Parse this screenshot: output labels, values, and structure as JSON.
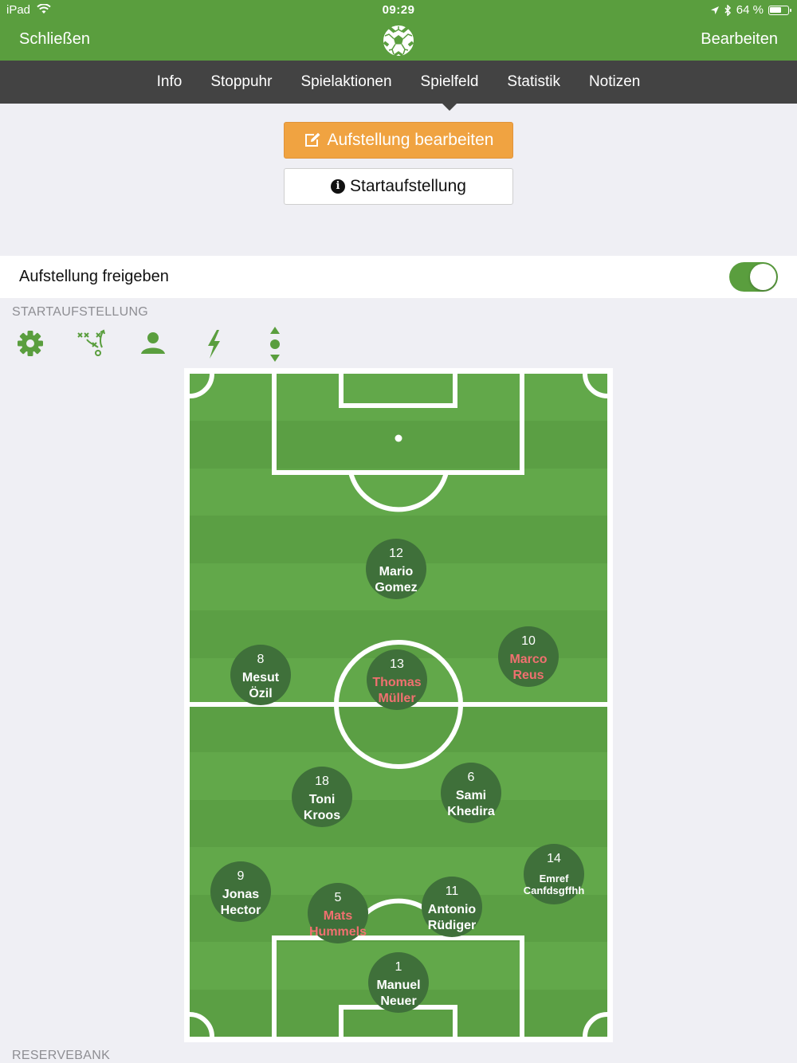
{
  "status_bar": {
    "device": "iPad",
    "time": "09:29",
    "battery": "64 %",
    "battery_level": 0.64
  },
  "nav": {
    "close": "Schließen",
    "edit": "Bearbeiten",
    "logo_icon": "soccer-ball-icon"
  },
  "tabs": [
    {
      "label": "Info"
    },
    {
      "label": "Stoppuhr"
    },
    {
      "label": "Spielaktionen"
    },
    {
      "label": "Spielfeld",
      "active": true
    },
    {
      "label": "Statistik"
    },
    {
      "label": "Notizen"
    }
  ],
  "buttons": {
    "edit_lineup": "Aufstellung bearbeiten",
    "starting_lineup": "Startaufstellung"
  },
  "share": {
    "label": "Aufstellung freigeben",
    "enabled": true
  },
  "sections": {
    "starting": "STARTAUFSTELLUNG",
    "bench": "RESERVEBANK"
  },
  "toolbar": [
    "gear-icon",
    "tactics-icon",
    "person-icon",
    "lightning-icon",
    "move-vertical-icon"
  ],
  "colors": {
    "brand_green": "#5a9e3e",
    "tab_bar": "#434343",
    "edit_button": "#f0a341",
    "player": "#3f703a",
    "highlight_name": "#f07070"
  },
  "players": [
    {
      "number": "12",
      "name1": "Mario",
      "name2": "Gomez",
      "highlight": false
    },
    {
      "number": "8",
      "name1": "Mesut",
      "name2": "Özil",
      "highlight": false
    },
    {
      "number": "13",
      "name1": "Thomas",
      "name2": "Müller",
      "highlight": true
    },
    {
      "number": "10",
      "name1": "Marco",
      "name2": "Reus",
      "highlight": true
    },
    {
      "number": "18",
      "name1": "Toni",
      "name2": "Kroos",
      "highlight": false
    },
    {
      "number": "6",
      "name1": "Sami",
      "name2": "Khedira",
      "highlight": false
    },
    {
      "number": "9",
      "name1": "Jonas",
      "name2": "Hector",
      "highlight": false
    },
    {
      "number": "5",
      "name1": "Mats",
      "name2": "Hummels",
      "highlight": true
    },
    {
      "number": "11",
      "name1": "Antonio",
      "name2": "Rüdiger",
      "highlight": false
    },
    {
      "number": "14",
      "name1": "Emref",
      "name2": "Canfdsgffhh",
      "highlight": false
    },
    {
      "number": "1",
      "name1": "Manuel",
      "name2": "Neuer",
      "highlight": false
    }
  ]
}
